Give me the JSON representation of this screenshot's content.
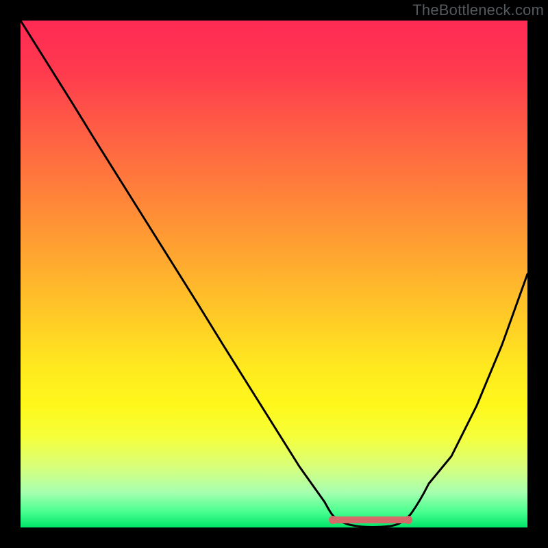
{
  "watermark": "TheBottleneck.com",
  "colors": {
    "frame_bg": "#000000",
    "curve_stroke": "#000000",
    "baseline": "#d46a6a",
    "gradient_top": "#ff2a55",
    "gradient_bottom": "#00e56a"
  },
  "chart_data": {
    "type": "line",
    "title": "",
    "xlabel": "",
    "ylabel": "",
    "xlim": [
      0,
      100
    ],
    "ylim": [
      0,
      100
    ],
    "x": [
      0,
      5,
      10,
      15,
      20,
      25,
      30,
      35,
      40,
      45,
      50,
      55,
      60,
      62,
      65,
      70,
      75,
      80,
      85,
      90,
      95,
      100
    ],
    "y": [
      100,
      92,
      84,
      76,
      68,
      60,
      52,
      44,
      36,
      28,
      20,
      12,
      5,
      2,
      0,
      0,
      1,
      5,
      14,
      24,
      36,
      50
    ],
    "baseline_segment": {
      "x_start": 62,
      "x_end": 76,
      "y": 0
    },
    "notes": "Single V-shaped curve overlaid on vertical red→green gradient. Values estimated from pixels; no axis ticks or labels rendered."
  }
}
